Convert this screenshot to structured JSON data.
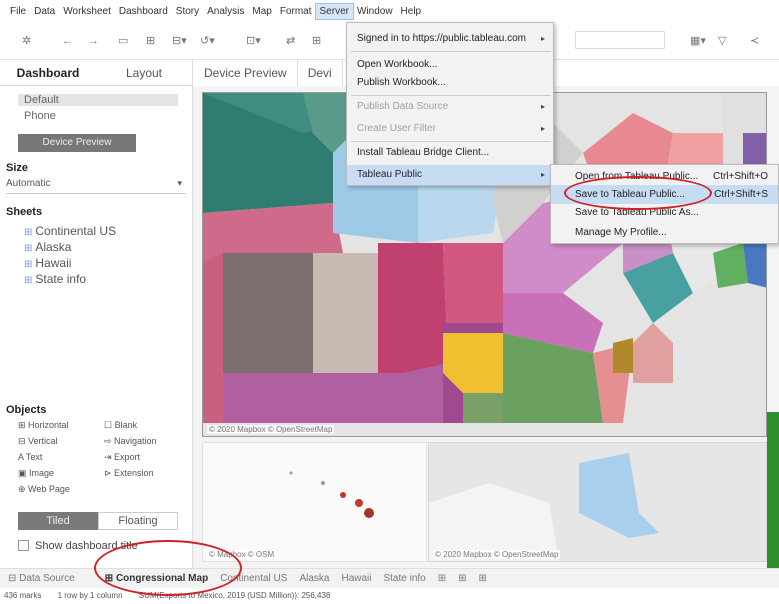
{
  "menubar": {
    "items": [
      "File",
      "Data",
      "Worksheet",
      "Dashboard",
      "Story",
      "Analysis",
      "Map",
      "Format",
      "Server",
      "Window",
      "Help"
    ],
    "active": "Server"
  },
  "sidebar": {
    "tabs": [
      "Dashboard",
      "Layout"
    ],
    "device_options": [
      "Default",
      "Phone"
    ],
    "device_preview_button": "Device Preview",
    "size_title": "Size",
    "size_value": "Automatic",
    "sheets_title": "Sheets",
    "sheets": [
      "Continental US",
      "Alaska",
      "Hawaii",
      "State info"
    ],
    "objects_title": "Objects",
    "objects": [
      "Horizontal",
      "Blank",
      "Vertical",
      "Navigation",
      "Text",
      "Export",
      "Image",
      "Extension",
      "Web Page"
    ],
    "tiled": "Tiled",
    "floating": "Floating",
    "show_title": "Show dashboard title"
  },
  "device_tabs": [
    "Device Preview",
    "Devi"
  ],
  "map": {
    "credit": "© 2020 Mapbox © OpenStreetMap",
    "mini_left_credit": "© Mapbox © OSM",
    "mini_right_credit": "© 2020 Mapbox © OpenStreetMap"
  },
  "server_menu": {
    "items": [
      {
        "label": "Signed in to https://public.tableau.com",
        "arrow": "▸",
        "state": "normal"
      },
      {
        "label": "Open Workbook...",
        "state": "normal"
      },
      {
        "label": "Publish Workbook...",
        "state": "normal"
      },
      {
        "label": "Publish Data Source",
        "arrow": "▸",
        "state": "disabled"
      },
      {
        "label": "Create User Filter",
        "arrow": "▸",
        "state": "disabled"
      },
      {
        "label": "Install Tableau Bridge Client...",
        "state": "normal"
      },
      {
        "label": "Tableau Public",
        "arrow": "▸",
        "state": "highlighted"
      }
    ]
  },
  "tableau_public_submenu": {
    "items": [
      {
        "label": "Open from Tableau Public...",
        "shortcut": "Ctrl+Shift+O"
      },
      {
        "label": "Save to Tableau Public...",
        "shortcut": "Ctrl+Shift+S"
      },
      {
        "label": "Save to Tableau Public As...",
        "shortcut": ""
      },
      {
        "label": "Manage My Profile...",
        "shortcut": ""
      }
    ]
  },
  "bottom_tabs": [
    "Data Source",
    "Congressional Map",
    "Continental US",
    "Alaska",
    "Hawaii",
    "State info"
  ],
  "active_bottom_tab": "Congressional Map",
  "status": {
    "marks": "436 marks",
    "rows": "1 row by 1 column",
    "sum": "SUM(Exports to Mexico, 2019 (USD Million)): 256,438"
  },
  "colors": {
    "highlight": "#c6dcf3",
    "annotation_red": "#d0212a",
    "menu_bg": "#f2f2f2"
  }
}
